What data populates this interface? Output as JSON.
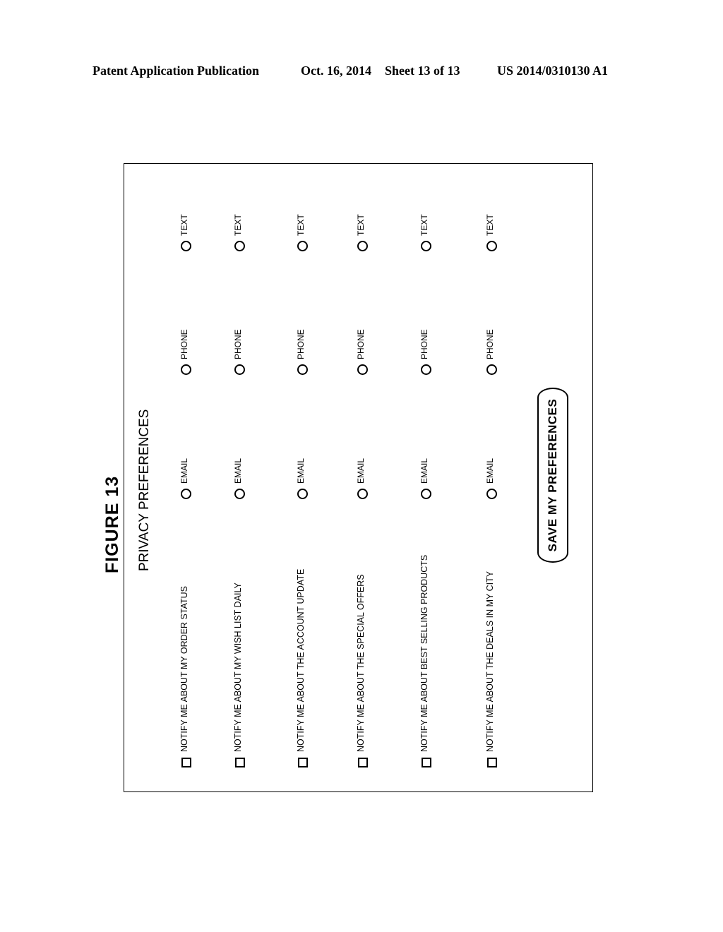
{
  "header": {
    "publication_type": "Patent Application Publication",
    "date": "Oct. 16, 2014",
    "sheet": "Sheet 13 of 13",
    "publication_number": "US 2014/0310130 A1"
  },
  "figure": {
    "label": "FIGURE  13",
    "orientation": "rotated 90° counter-clockwise"
  },
  "form": {
    "title": "PRIVACY PREFERENCES",
    "rows": [
      {
        "label": "NOTIFY ME ABOUT MY ORDER STATUS",
        "checked": false
      },
      {
        "label": "NOTIFY ME ABOUT MY WISH LIST DAILY",
        "checked": false
      },
      {
        "label": "NOTIFY ME ABOUT THE ACCOUNT UPDATE",
        "checked": false
      },
      {
        "label": "NOTIFY ME ABOUT THE SPECIAL OFFERS",
        "checked": false
      },
      {
        "label": "NOTIFY ME ABOUT BEST SELLING PRODUCTS",
        "checked": false
      },
      {
        "label": "NOTIFY ME ABOUT THE DEALS IN MY CITY",
        "checked": false
      }
    ],
    "options": [
      "EMAIL",
      "PHONE",
      "TEXT"
    ],
    "save_button_label": "SAVE MY PREFERENCES"
  }
}
